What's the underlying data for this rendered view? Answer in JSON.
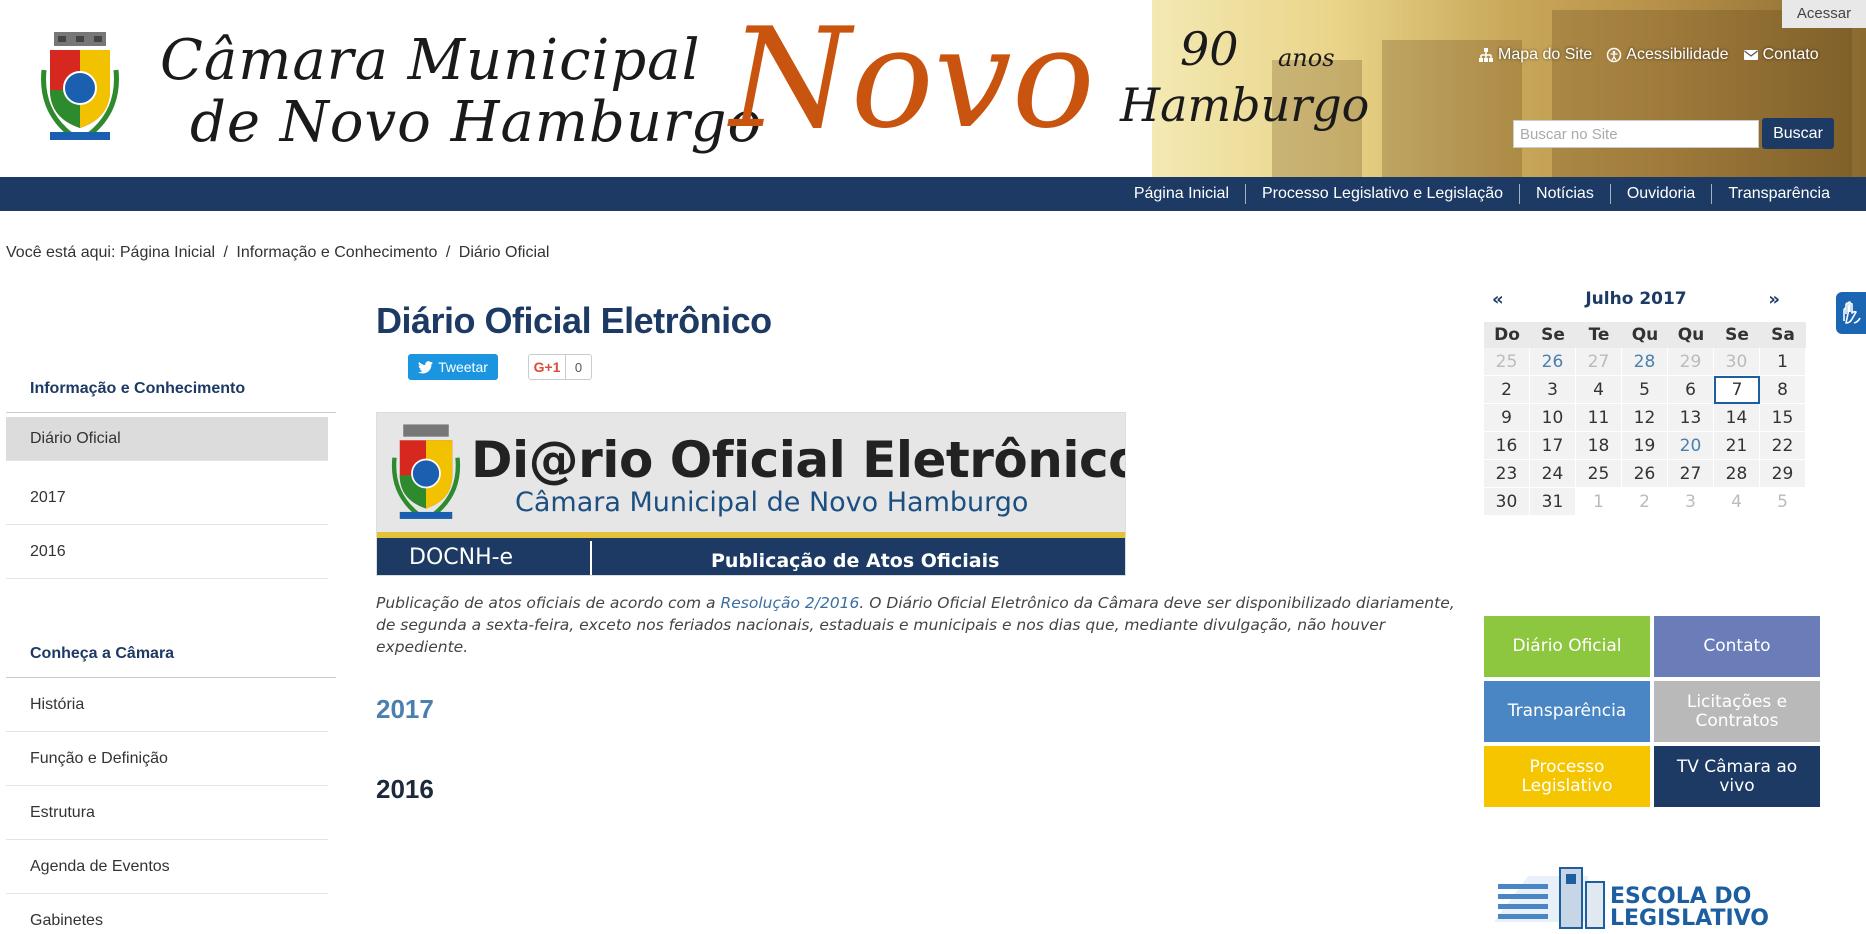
{
  "header": {
    "camara_line1": "Câmara Municipal",
    "camara_line2": "de Novo Hamburgo",
    "novo": "Novo",
    "anos_number": "90",
    "anos_word": "anos",
    "anos_city": "Hamburgo",
    "acessar": "Acessar",
    "top_links": {
      "mapa": "Mapa do Site",
      "acessibilidade": "Acessibilidade",
      "contato": "Contato"
    },
    "search_placeholder": "Buscar no Site",
    "search_button": "Buscar"
  },
  "nav": {
    "items": [
      "Página Inicial",
      "Processo Legislativo e Legislação",
      "Notícias",
      "Ouvidoria",
      "Transparência"
    ]
  },
  "breadcrumb": {
    "prefix": "Você está aqui:",
    "items": [
      "Página Inicial",
      "Informação e Conhecimento",
      "Diário Oficial"
    ]
  },
  "sidebar": {
    "section1_title": "Informação e Conhecimento",
    "section1_items": [
      "Diário Oficial",
      "2017",
      "2016"
    ],
    "section2_title": "Conheça a Câmara",
    "section2_items": [
      "História",
      "Função e Definição",
      "Estrutura",
      "Agenda de Eventos",
      "Gabinetes"
    ]
  },
  "main": {
    "title": "Diário Oficial Eletrônico",
    "tweet": "Tweetar",
    "gplus": "G+1",
    "gplus_count": "0",
    "banner": {
      "title": "Di@rio Oficial Eletrônico",
      "subtitle": "Câmara Municipal de Novo Hamburgo",
      "code": "DOCNH-e",
      "tagline": "Publicação de Atos Oficiais"
    },
    "intro_before": "Publicação de atos oficiais de acordo com a ",
    "intro_link": "Resolução 2/2016",
    "intro_after": ". O Diário Oficial Eletrônico da Câmara deve ser disponibilizado diariamente, de segunda a sexta-feira, exceto nos feriados nacionais, estaduais e municipais e nos dias que, mediante divulgação, não houver expediente.",
    "year1": "2017",
    "year2": "2016"
  },
  "calendar": {
    "prev": "«",
    "next": "»",
    "title": "Julho 2017",
    "weekdays": [
      "Do",
      "Se",
      "Te",
      "Qu",
      "Qu",
      "Se",
      "Sa"
    ],
    "weeks": [
      [
        "25",
        "26",
        "27",
        "28",
        "29",
        "30",
        "1"
      ],
      [
        "2",
        "3",
        "4",
        "5",
        "6",
        "7",
        "8"
      ],
      [
        "9",
        "10",
        "11",
        "12",
        "13",
        "14",
        "15"
      ],
      [
        "16",
        "17",
        "18",
        "19",
        "20",
        "21",
        "22"
      ],
      [
        "23",
        "24",
        "25",
        "26",
        "27",
        "28",
        "29"
      ],
      [
        "30",
        "31",
        "1",
        "2",
        "3",
        "4",
        "5"
      ]
    ]
  },
  "quick_links": [
    {
      "label": "Diário Oficial",
      "color": "#8dc63f"
    },
    {
      "label": "Contato",
      "color": "#6a7db8"
    },
    {
      "label": "Transparência",
      "color": "#4a86c4"
    },
    {
      "label": "Licitações e Contratos",
      "color": "#b9b9b9"
    },
    {
      "label": "Processo Legislativo",
      "color": "#f5c500"
    },
    {
      "label": "TV Câmara ao vivo",
      "color": "#1c3a63"
    }
  ],
  "escola": {
    "line1": "ESCOLA DO",
    "line2": "LEGISLATIVO"
  },
  "colors": {
    "navy": "#1c3a63",
    "orange": "#c9540f",
    "link_blue": "#4a7faf"
  }
}
